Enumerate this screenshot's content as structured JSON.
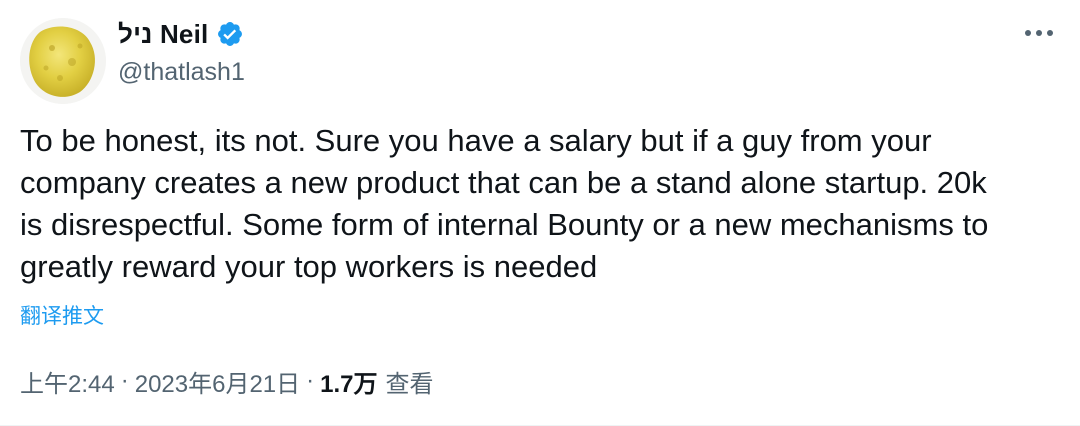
{
  "author": {
    "display_name": "ניל Neil",
    "handle": "@thatlash1",
    "verified": true,
    "avatar_icon": "cheese-puff-avatar"
  },
  "tweet": {
    "text": "To be honest, its not. Sure you have a salary but if a guy from your\ncompany creates a new product that can be a stand alone startup. 20k\nis disrespectful. Some form of internal Bounty or a new mechanisms to\ngreatly reward your top workers is needed",
    "translate_label": "翻译推文"
  },
  "meta": {
    "time": "上午2:44",
    "separator": "·",
    "date": "2023年6月21日",
    "views_count": "1.7万",
    "views_label": "查看"
  },
  "colors": {
    "text_primary": "#0f1419",
    "text_secondary": "#536471",
    "link": "#1d9bf0",
    "verified": "#1d9bf0"
  },
  "icons": {
    "more": "more-horizontal-icon",
    "verified": "verified-badge-icon"
  }
}
